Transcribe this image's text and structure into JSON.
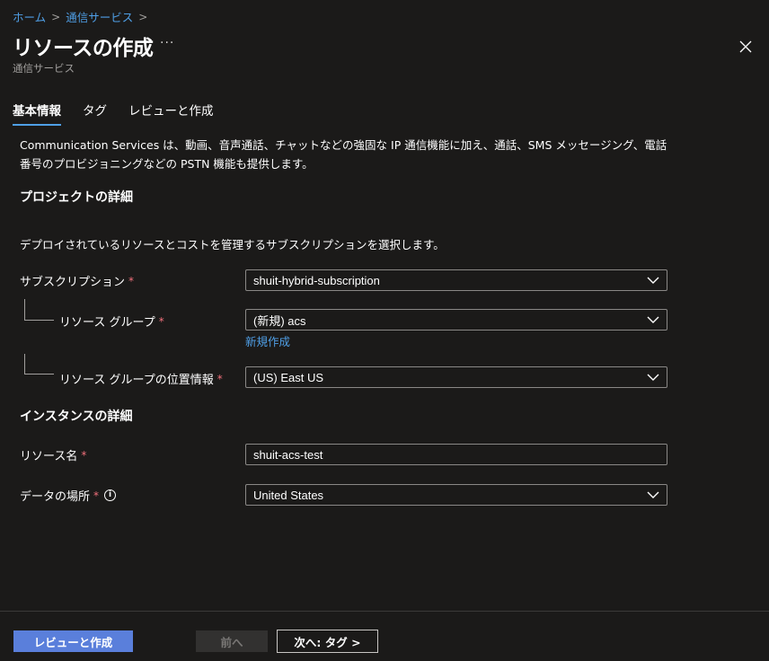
{
  "breadcrumb": {
    "home": "ホーム",
    "service": "通信サービス",
    "separator": ">"
  },
  "header": {
    "title": "リソースの作成",
    "more": "···",
    "subtitle": "通信サービス"
  },
  "tabs": [
    {
      "label": "基本情報",
      "active": true
    },
    {
      "label": "タグ",
      "active": false
    },
    {
      "label": "レビューと作成",
      "active": false
    }
  ],
  "description": "Communication Services は、動画、音声通話、チャットなどの強固な IP 通信機能に加え、通話、SMS メッセージング、電話番号のプロビジョニングなどの PSTN 機能も提供します。",
  "project": {
    "heading": "プロジェクトの詳細",
    "text": "デプロイされているリソースとコストを管理するサブスクリプションを選択します。",
    "subscription_label": "サブスクリプション",
    "subscription_value": "shuit-hybrid-subscription",
    "resource_group_label": "リソース グループ",
    "resource_group_value": "(新規) acs",
    "create_new_link": "新規作成",
    "location_label": "リソース グループの位置情報",
    "location_value": "(US) East US"
  },
  "instance": {
    "heading": "インスタンスの詳細",
    "resource_name_label": "リソース名",
    "resource_name_value": "shuit-acs-test",
    "data_location_label": "データの場所",
    "data_location_value": "United States"
  },
  "required_mark": "*",
  "info_icon_glyph": "i",
  "footer": {
    "review_button": "レビューと作成",
    "prev_button": "前へ",
    "next_button": "次へ: タグ >"
  },
  "colors": {
    "background": "#1b1a19",
    "link": "#4f9fe6",
    "primary_button": "#5a7fdb",
    "required": "#f1707b"
  }
}
